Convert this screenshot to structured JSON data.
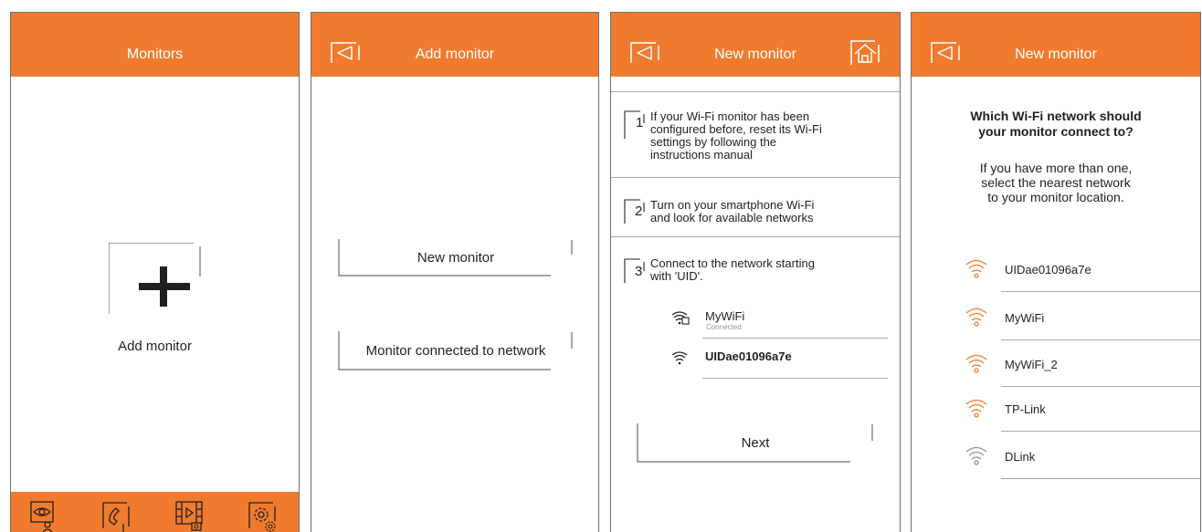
{
  "colors": {
    "accent": "#f07b2e",
    "text": "#231f20",
    "line": "#a7a9ac",
    "muted": "#939598"
  },
  "screen_monitors": {
    "title": "Monitors",
    "add_label": "Add monitor",
    "tabs": [
      "eye-person-icon",
      "phone-icon",
      "video-gallery-icon",
      "settings-icon"
    ]
  },
  "screen_add": {
    "title": "Add monitor",
    "new_button": "New monitor",
    "connected_button": "Monitor connected to network"
  },
  "screen_new": {
    "title": "New monitor",
    "steps": [
      {
        "num": "1",
        "lines": [
          "If your Wi-Fi monitor has been",
          "configured before, reset its Wi-Fi",
          "settings by following the",
          "instructions manual"
        ]
      },
      {
        "num": "2",
        "lines": [
          "Turn on your smartphone Wi-Fi",
          "and look for available networks"
        ]
      },
      {
        "num": "3",
        "lines": [
          "Connect to the network starting",
          "with 'UID'."
        ]
      }
    ],
    "wifi": [
      {
        "name": "MyWiFi",
        "status": "Connected"
      },
      {
        "name": "UIDae01096a7e",
        "status": ""
      }
    ],
    "next_button": "Next"
  },
  "screen_select": {
    "title": "New monitor",
    "question_lines": [
      "Which Wi-Fi network should",
      "your monitor connect to?"
    ],
    "hint_lines": [
      "If you have more than one,",
      "select the nearest network",
      "to your monitor location."
    ],
    "networks": [
      {
        "name": "UIDae01096a7e",
        "signal": "strong"
      },
      {
        "name": "MyWiFi",
        "signal": "strong"
      },
      {
        "name": "MyWiFi_2",
        "signal": "strong"
      },
      {
        "name": "TP-Link",
        "signal": "strong"
      },
      {
        "name": "DLink",
        "signal": "weak"
      }
    ]
  }
}
